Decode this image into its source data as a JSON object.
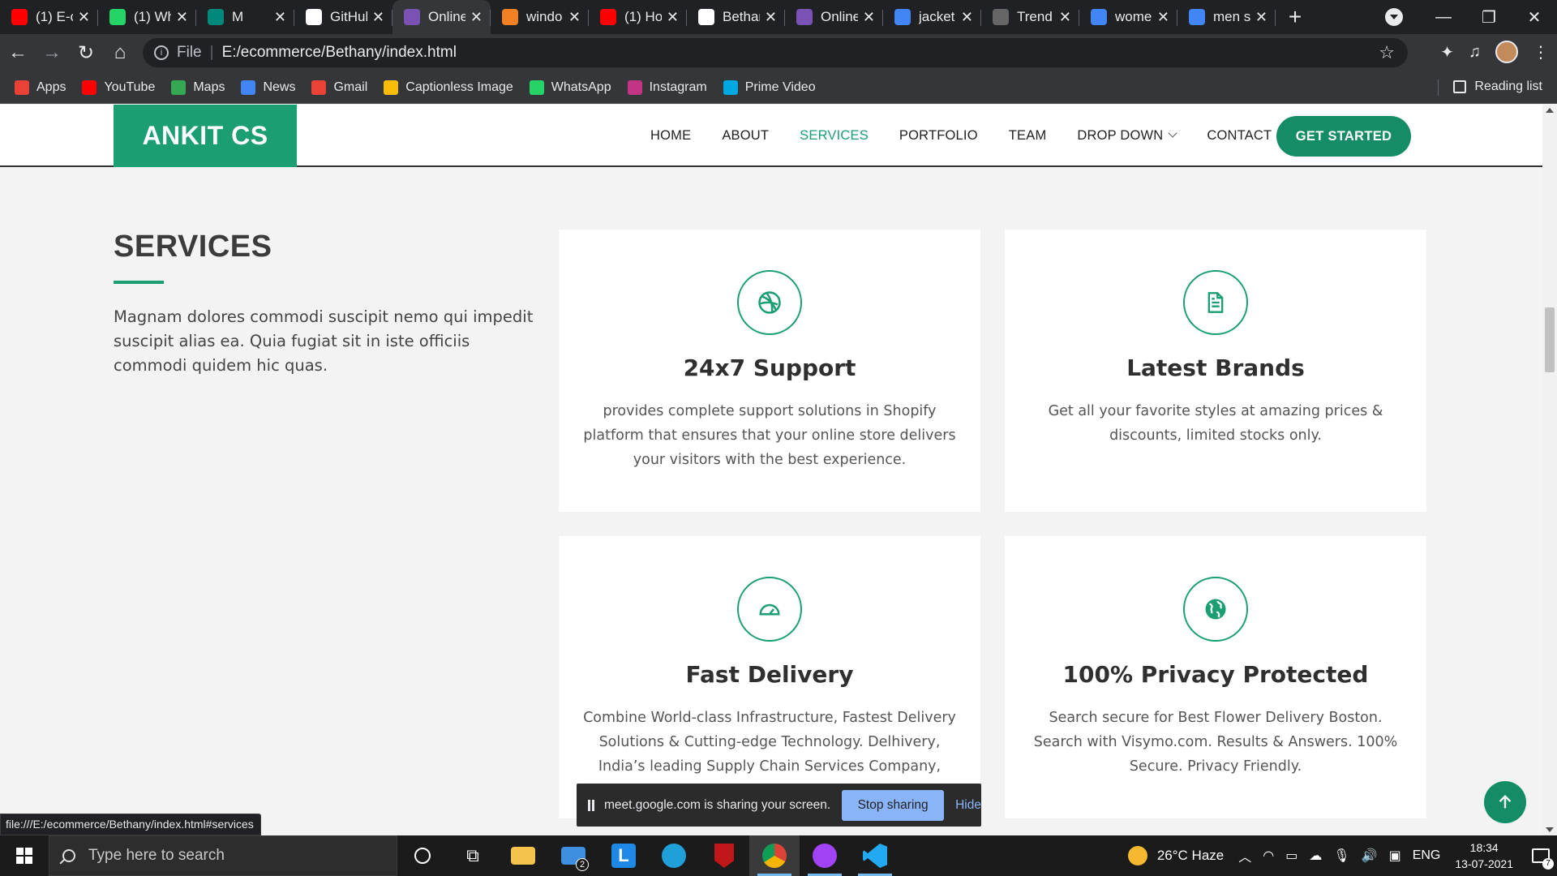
{
  "browser": {
    "tabs": [
      {
        "label": "(1) E-c",
        "icon": "youtube-icon",
        "color": "#ff0000"
      },
      {
        "label": "(1) Wh",
        "icon": "whatsapp-icon",
        "color": "#25d366"
      },
      {
        "label": "M",
        "icon": "meet-icon",
        "color": "#00897b"
      },
      {
        "label": "GitHul",
        "icon": "github-icon",
        "color": "#ffffff"
      },
      {
        "label": "Online",
        "icon": "bootstrap-icon",
        "color": "#7952b3"
      },
      {
        "label": "windo",
        "icon": "stackoverflow-icon",
        "color": "#f48024"
      },
      {
        "label": "(1) Ho",
        "icon": "youtube-icon",
        "color": "#ff0000"
      },
      {
        "label": "Bethar",
        "icon": "globe-icon",
        "color": "#ffffff"
      },
      {
        "label": "Online",
        "icon": "bootstrap-icon",
        "color": "#7952b3"
      },
      {
        "label": "jacket",
        "icon": "google-icon",
        "color": "#4285f4"
      },
      {
        "label": "Trend",
        "icon": "trendyol-icon",
        "color": "#666666"
      },
      {
        "label": "wome",
        "icon": "google-icon",
        "color": "#4285f4"
      },
      {
        "label": "men s",
        "icon": "google-icon",
        "color": "#4285f4"
      }
    ],
    "active_tab_index": 4,
    "new_tab_symbol": "+",
    "url_scheme": "File",
    "url": "E:/ecommerce/Bethany/index.html",
    "bookmarks": [
      {
        "label": "Apps",
        "icon": "apps-grid-icon",
        "color": "#ea4335"
      },
      {
        "label": "YouTube",
        "icon": "youtube-icon",
        "color": "#ff0000"
      },
      {
        "label": "Maps",
        "icon": "maps-pin-icon",
        "color": "#34a853"
      },
      {
        "label": "News",
        "icon": "google-news-icon",
        "color": "#4285f4"
      },
      {
        "label": "Gmail",
        "icon": "gmail-icon",
        "color": "#ea4335"
      },
      {
        "label": "Captionless Image",
        "icon": "pinwheel-icon",
        "color": "#fbbc05"
      },
      {
        "label": "WhatsApp",
        "icon": "whatsapp-icon",
        "color": "#25d366"
      },
      {
        "label": "Instagram",
        "icon": "instagram-icon",
        "color": "#c13584"
      },
      {
        "label": "Prime Video",
        "icon": "prime-video-icon",
        "color": "#00a8e1"
      }
    ],
    "reading_list": "Reading list",
    "status_url": "file:///E:/ecommerce/Bethany/index.html#services"
  },
  "site": {
    "logo": "ANKIT CS",
    "nav": [
      "HOME",
      "ABOUT",
      "SERVICES",
      "PORTFOLIO",
      "TEAM",
      "DROP DOWN",
      "CONTACT"
    ],
    "active_nav": "SERVICES",
    "cta": "GET STARTED",
    "accent_color": "#1a9e72"
  },
  "services": {
    "title": "SERVICES",
    "description": "Magnam dolores commodi suscipit nemo qui impedit suscipit alias ea. Quia fugiat sit in iste officiis commodi quidem hic quas.",
    "cards": [
      {
        "title": "24x7 Support",
        "icon": "dribbble-icon",
        "text": "provides complete support solutions in Shopify platform that ensures that your online store delivers your visitors with the best experience."
      },
      {
        "title": "Latest Brands",
        "icon": "document-icon",
        "text": "Get all your favorite styles at amazing prices & discounts, limited stocks only."
      },
      {
        "title": "Fast Delivery",
        "icon": "speedometer-icon",
        "text": "Combine World-class Infrastructure, Fastest Delivery Solutions & Cutting-edge Technology. Delhivery, India’s leading Supply Chain Services Company, Provides fastest"
      },
      {
        "title": "100% Privacy Protected",
        "icon": "globe-icon",
        "text": "Search secure for Best Flower Delivery Boston. Search with Visymo.com. Results & Answers. 100% Secure. Privacy Friendly."
      }
    ]
  },
  "screen_share": {
    "message": "meet.google.com is sharing your screen.",
    "stop_label": "Stop sharing",
    "hide_label": "Hide"
  },
  "taskbar": {
    "search_placeholder": "Type here to search",
    "weather": "26°C  Haze",
    "language": "ENG",
    "time": "18:34",
    "date": "13-07-2021",
    "notification_count": "7",
    "mail_badge": "2"
  }
}
